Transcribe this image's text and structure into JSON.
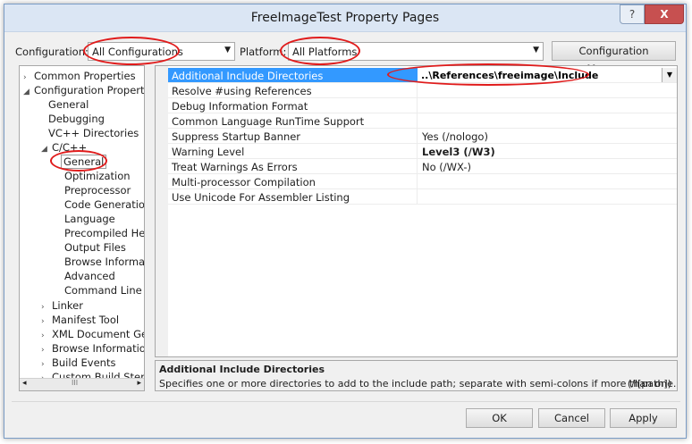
{
  "window": {
    "title": "FreeImageTest Property Pages",
    "help": "?",
    "close": "X"
  },
  "toolbar": {
    "configuration_label": "Configuration:",
    "configuration_value": "All Configurations",
    "platform_label": "Platform:",
    "platform_value": "All Platforms",
    "config_manager_label": "Configuration Manager..."
  },
  "tree": {
    "items": [
      {
        "label": "Common Properties"
      },
      {
        "label": "Configuration Properties"
      },
      {
        "label": "General"
      },
      {
        "label": "Debugging"
      },
      {
        "label": "VC++ Directories"
      },
      {
        "label": "C/C++"
      },
      {
        "label": "General"
      },
      {
        "label": "Optimization"
      },
      {
        "label": "Preprocessor"
      },
      {
        "label": "Code Generation"
      },
      {
        "label": "Language"
      },
      {
        "label": "Precompiled Head"
      },
      {
        "label": "Output Files"
      },
      {
        "label": "Browse Informatic"
      },
      {
        "label": "Advanced"
      },
      {
        "label": "Command Line"
      },
      {
        "label": "Linker"
      },
      {
        "label": "Manifest Tool"
      },
      {
        "label": "XML Document Gene"
      },
      {
        "label": "Browse Information"
      },
      {
        "label": "Build Events"
      },
      {
        "label": "Custom Build Step"
      }
    ],
    "scroll_mark": "III"
  },
  "grid": {
    "rows": [
      {
        "name": "Additional Include Directories",
        "value": "..\\References\\freeimage\\Include"
      },
      {
        "name": "Resolve #using References",
        "value": ""
      },
      {
        "name": "Debug Information Format",
        "value": ""
      },
      {
        "name": "Common Language RunTime Support",
        "value": ""
      },
      {
        "name": "Suppress Startup Banner",
        "value": "Yes (/nologo)"
      },
      {
        "name": "Warning Level",
        "value": "Level3 (/W3)"
      },
      {
        "name": "Treat Warnings As Errors",
        "value": "No (/WX-)"
      },
      {
        "name": "Multi-processor Compilation",
        "value": ""
      },
      {
        "name": "Use Unicode For Assembler Listing",
        "value": ""
      }
    ]
  },
  "description": {
    "title": "Additional Include Directories",
    "text": "Specifies one or more directories to add to the include path; separate with semi-colons if more than one.",
    "switch": "(/I[path])"
  },
  "buttons": {
    "ok": "OK",
    "cancel": "Cancel",
    "apply": "Apply"
  },
  "colors": {
    "selection": "#3399ff",
    "annotation": "#e01b1b"
  }
}
